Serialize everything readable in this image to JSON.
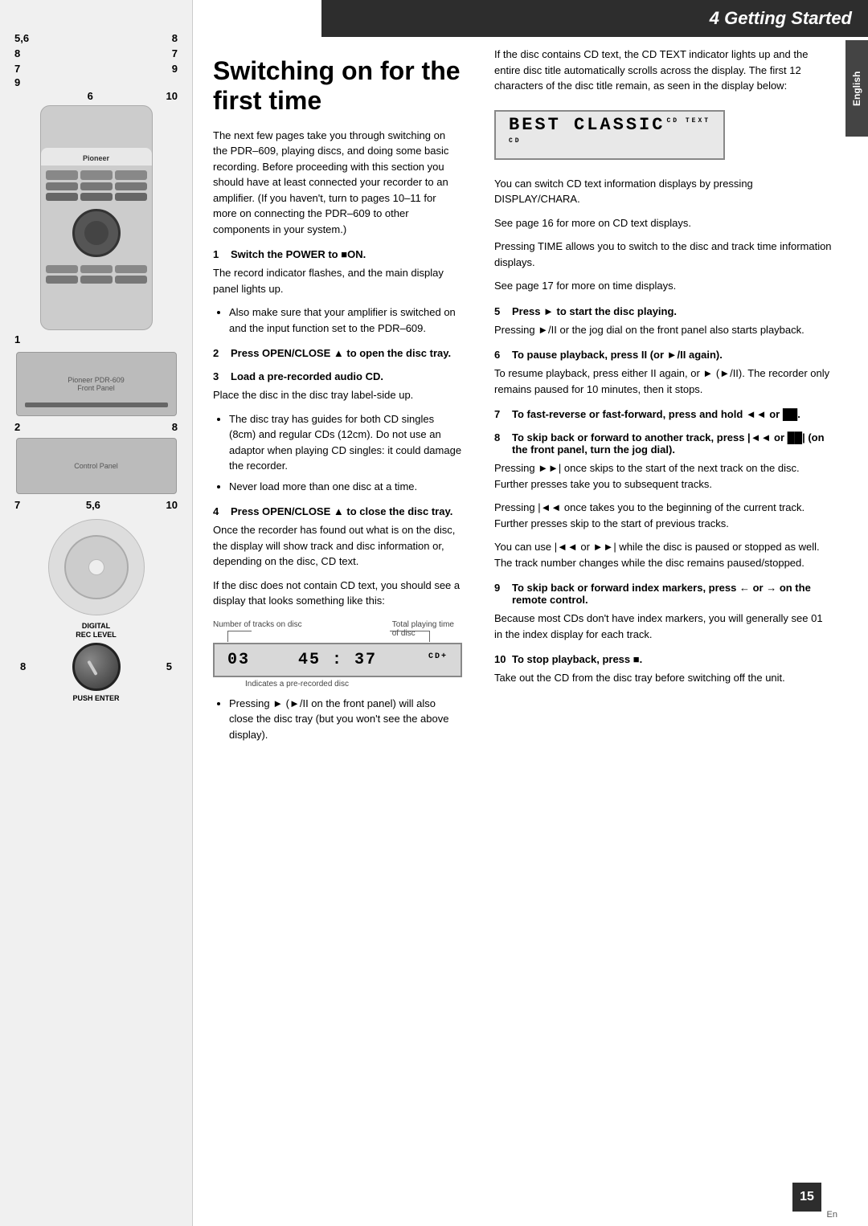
{
  "header": {
    "chapter": "4 Getting Started",
    "bg_color": "#2d2d2d"
  },
  "page_number": "15",
  "en_label": "En",
  "english_tab": "English",
  "left_labels": {
    "top_left": "5,6",
    "top_right1": "8",
    "mid_left1": "8",
    "mid_right1": "7",
    "mid_left2": "7",
    "mid_right2": "9",
    "mid_left3": "9",
    "bot_left": "6",
    "bot_right": "10",
    "section2_left": "1",
    "section3_left": "2",
    "section3_right": "8",
    "section4_left": "7",
    "section4_mid": "5,6",
    "section4_right": "10",
    "knob_top": "DIGITAL\nREC LEVEL",
    "knob_left": "8",
    "knob_right": "5",
    "knob_bottom": "PUSH ENTER"
  },
  "main_title": "Switching on for the first time",
  "intro_text": "The next few pages take you through switching on the PDR–609, playing discs, and doing some basic recording. Before proceeding with this section you should have at least connected your recorder to an amplifier. (If you haven't, turn to pages 10–11 for more on connecting the PDR–609 to other components in your system.)",
  "steps": [
    {
      "num": "1",
      "title": "Switch the POWER to ■ON.",
      "body": "The record indicator flashes, and the main display panel lights up.",
      "bullets": [
        "Also make sure that your amplifier is switched on and the input function set to the PDR–609."
      ]
    },
    {
      "num": "2",
      "title": "Press OPEN/CLOSE ▲ to open the disc tray."
    },
    {
      "num": "3",
      "title": "Load a pre-recorded audio CD.",
      "body": "Place the disc in the disc tray label-side up.",
      "bullets": [
        "The disc tray has guides for both CD singles (8cm) and regular CDs (12cm). Do not use an adaptor when playing CD singles: it could damage the recorder.",
        "Never load more than one disc at a time."
      ]
    },
    {
      "num": "4",
      "title": "Press OPEN/CLOSE ▲ to close the disc tray.",
      "body": "Once the recorder has found out what is on the disc, the display will show track and disc information or, depending on the disc, CD text.",
      "body2": "If the disc does not contain CD text, you should see a display that looks something like this:"
    }
  ],
  "display_section": {
    "track_label": "Number of tracks on disc",
    "time_label": "Total playing time\nof disc",
    "track_num": "03",
    "time": "45 : 37",
    "cd_indicator": "CD+",
    "pre_recorded_label": "Indicates a pre-recorded disc"
  },
  "pressing_bullet": "Pressing ► (►/II on the front panel) will also close the disc tray (but you won't see the above display).",
  "right_column": {
    "cd_text_intro": "If the disc contains CD text, the CD TEXT indicator lights up and the entire disc title automatically scrolls across the display. The first 12 characters of the disc title remain, as seen in the display below:",
    "best_classic_display": "BEST CLASSIC",
    "cd_text_label": "CD TEXT",
    "cd_label": "CD",
    "display_chara_text": "You can switch CD text information displays by pressing DISPLAY/CHARA.",
    "page16_ref": "See page 16 for more on CD text displays.",
    "pressing_time": "Pressing TIME allows you to switch to the disc and track time information displays.",
    "page17_ref": "See page 17 for more on time displays.",
    "steps": [
      {
        "num": "5",
        "title": "Press ► to start the disc playing.",
        "body": "Pressing ►/II or the jog dial on the front panel also starts playback."
      },
      {
        "num": "6",
        "title": "To pause playback, press II (or ►/II again).",
        "body": "To resume playback, press either II again, or ► (►/II). The recorder only remains paused for 10 minutes, then it stops."
      },
      {
        "num": "7",
        "title": "To fast-reverse or fast-forward, press and hold ◄◄ or ►►."
      },
      {
        "num": "8",
        "title": "To skip back or forward to another track, press |◄◄ or ►►| (on the front panel, turn the jog dial).",
        "body": "Pressing ►►| once skips to the start of the next track on the disc. Further presses take you to subsequent tracks.",
        "body2": "Pressing |◄◄ once takes you to the beginning of the current track. Further presses skip to the start of previous tracks.",
        "body3": "You can use |◄◄ or ►►| while the disc is paused or stopped as well. The track number changes while the disc remains paused/stopped."
      },
      {
        "num": "9",
        "title": "To skip back or forward index markers, press ← or → on the remote control.",
        "body": "Because most CDs don't have index markers, you will generally see 01 in the index display for each track."
      },
      {
        "num": "10",
        "title": "To stop playback, press ■.",
        "body": "Take out the CD from the disc tray before switching off the unit."
      }
    ]
  }
}
